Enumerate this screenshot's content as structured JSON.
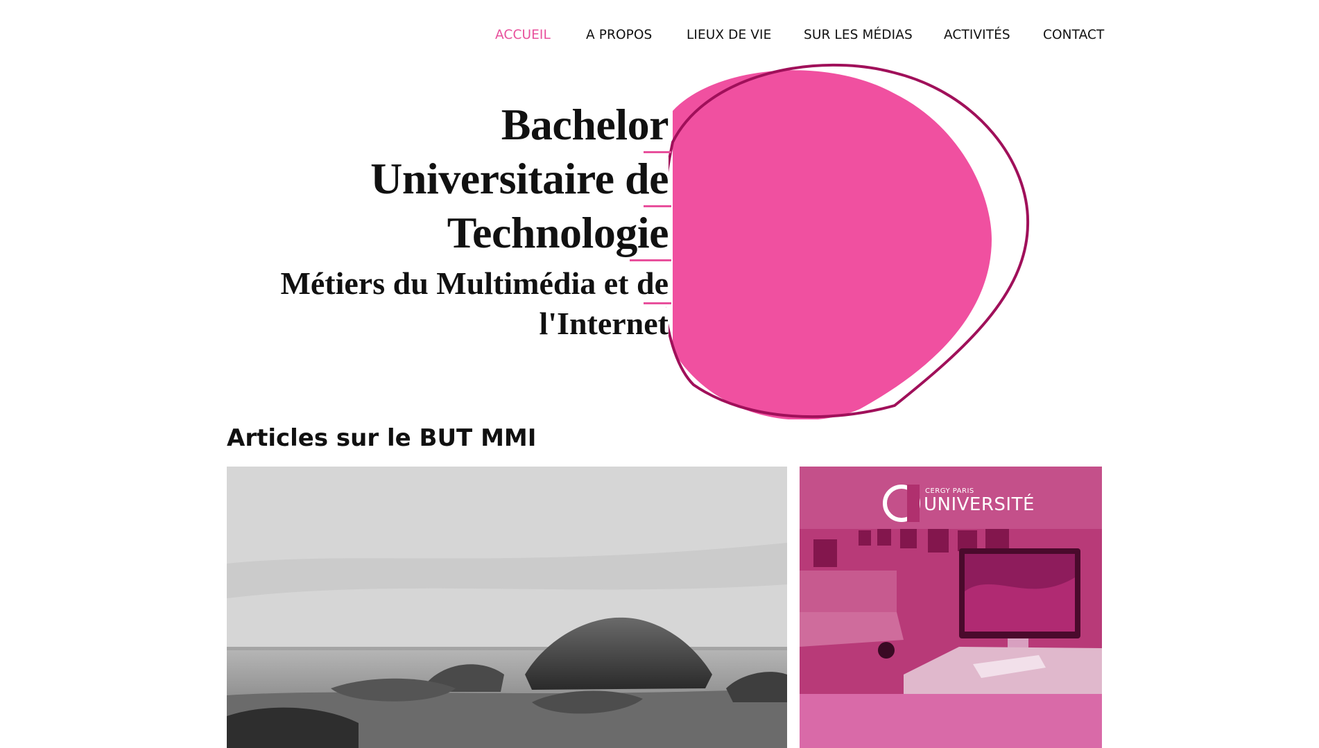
{
  "nav": {
    "items": [
      {
        "label": "ACCUEIL",
        "active": true
      },
      {
        "label": "A PROPOS",
        "active": false
      },
      {
        "label": "LIEUX DE VIE",
        "active": false
      },
      {
        "label": "SUR LES MÉDIAS",
        "active": false
      },
      {
        "label": "ACTIVITÉS",
        "active": false
      },
      {
        "label": "CONTACT",
        "active": false
      }
    ]
  },
  "hero": {
    "title_lines": [
      "Bachelor",
      "Universitaire de",
      "Technologie"
    ],
    "subtitle_lines": [
      "Métiers du Multimédia et de",
      "l'Internet"
    ]
  },
  "articles": {
    "title": "Articles sur le BUT MMI"
  },
  "logo": {
    "mark": "CY",
    "small": "CERGY PARIS",
    "big": "UNIVERSITÉ"
  },
  "colors": {
    "accent": "#e8509c",
    "blob_fill": "#f050a0",
    "blob_outline": "#a0105a",
    "card_overlay": "#c0307a"
  }
}
